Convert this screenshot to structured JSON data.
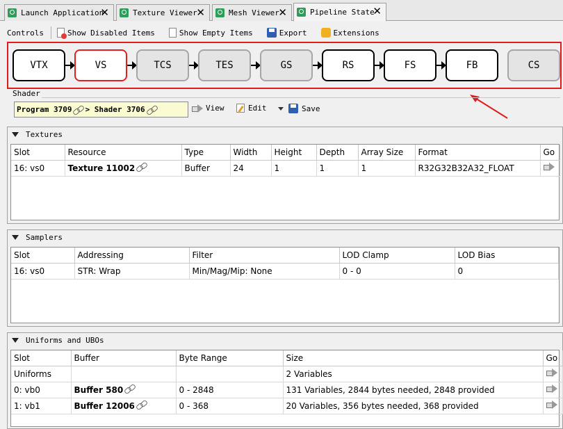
{
  "tabs": [
    {
      "label": "Launch Application",
      "close": "✕"
    },
    {
      "label": "Texture Viewer",
      "close": "✕"
    },
    {
      "label": "Mesh Viewer",
      "close": "✕"
    },
    {
      "label": "Pipeline State",
      "close": "✕"
    }
  ],
  "toolbar": {
    "controls": "Controls",
    "show_disabled": "Show Disabled Items",
    "show_empty": "Show Empty Items",
    "export": "Export",
    "extensions": "Extensions"
  },
  "pipeline": {
    "stages": [
      "VTX",
      "VS",
      "TCS",
      "TES",
      "GS",
      "RS",
      "FS",
      "FB",
      "CS"
    ],
    "selected": "VS",
    "disabled": [
      "TCS",
      "TES",
      "GS",
      "CS"
    ]
  },
  "shader": {
    "label": "Shader",
    "program": "Program 3709",
    "separator": ">",
    "shader": "Shader 3706",
    "view": "View",
    "edit": "Edit",
    "save": "Save"
  },
  "textures": {
    "title": "Textures",
    "columns": [
      "Slot",
      "Resource",
      "Type",
      "Width",
      "Height",
      "Depth",
      "Array Size",
      "Format",
      "Go"
    ],
    "rows": [
      [
        "16: vs0",
        "Texture 11002",
        "Buffer",
        "24",
        "1",
        "1",
        "1",
        "R32G32B32A32_FLOAT"
      ]
    ]
  },
  "samplers": {
    "title": "Samplers",
    "columns": [
      "Slot",
      "Addressing",
      "Filter",
      "LOD Clamp",
      "LOD Bias"
    ],
    "rows": [
      [
        "16: vs0",
        "STR: Wrap",
        "Min/Mag/Mip: None",
        "0 - 0",
        "0"
      ]
    ]
  },
  "uniforms": {
    "title": "Uniforms and UBOs",
    "columns": [
      "Slot",
      "Buffer",
      "Byte Range",
      "Size",
      "Go"
    ],
    "rows": [
      [
        "Uniforms",
        "",
        "",
        "2 Variables"
      ],
      [
        "0: vb0",
        "Buffer 580",
        "0 - 2848",
        "131 Variables, 2844 bytes needed, 2848 provided"
      ],
      [
        "1: vb1",
        "Buffer 12006",
        "0 - 368",
        "20 Variables, 356 bytes needed, 368 provided"
      ]
    ]
  },
  "colors": {
    "highlight": "#e01c1c",
    "tab_icon": "#2f9d5a",
    "shader_bg": "#fbfbd2"
  }
}
